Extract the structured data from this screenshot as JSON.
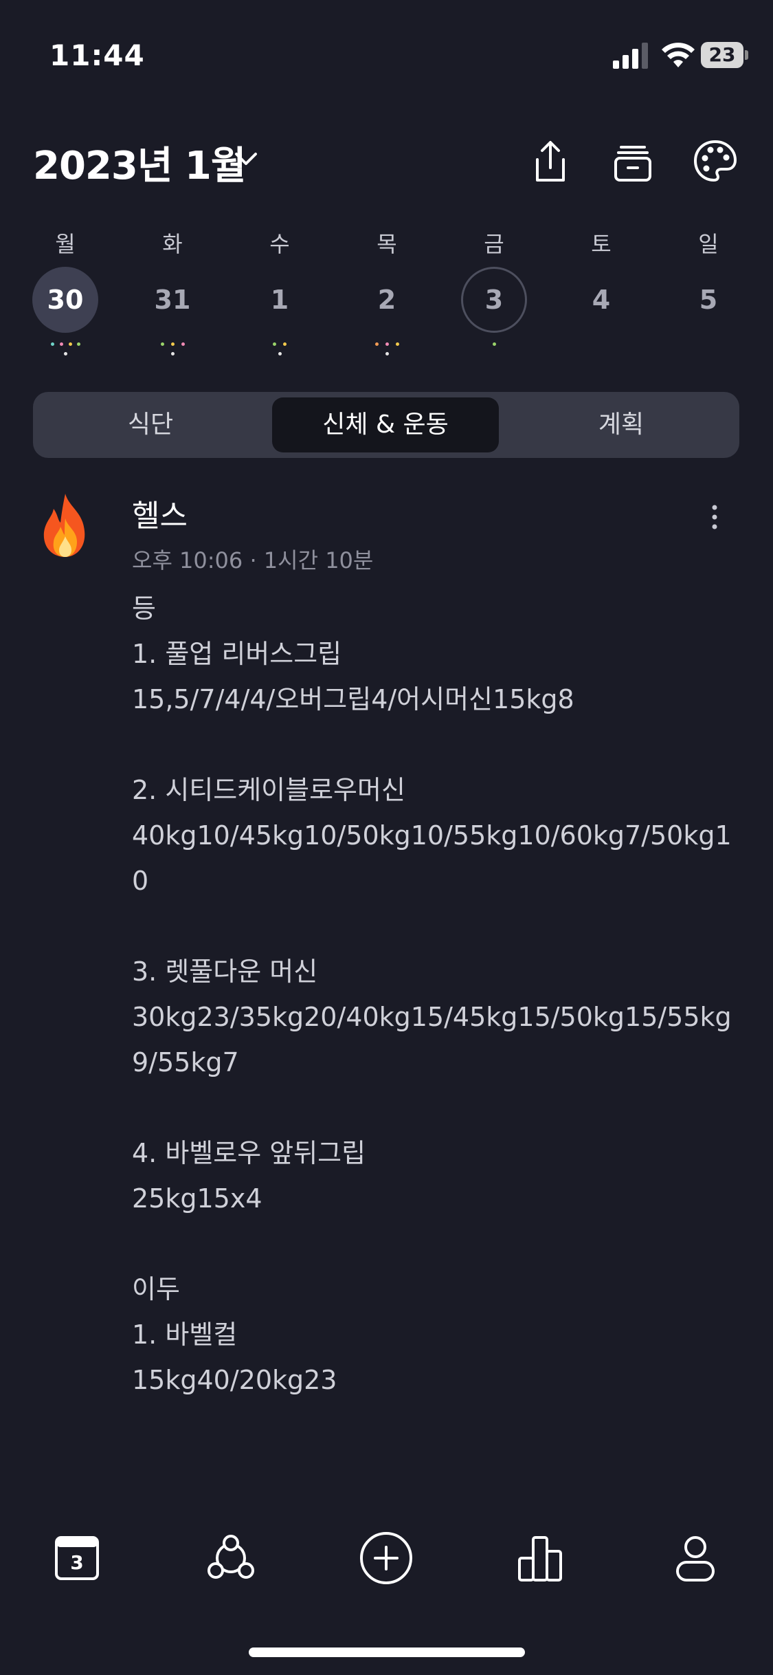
{
  "status_bar": {
    "time": "11:44",
    "battery": "23",
    "icons": [
      "signal-icon",
      "wifi-icon",
      "battery-icon"
    ]
  },
  "header": {
    "month_title": "2023년 1월",
    "icons": [
      "chevron-down-icon",
      "share-icon",
      "archive-icon",
      "palette-icon"
    ]
  },
  "week": [
    {
      "label": "월",
      "num": "30",
      "state": "selected"
    },
    {
      "label": "화",
      "num": "31",
      "state": ""
    },
    {
      "label": "수",
      "num": "1",
      "state": ""
    },
    {
      "label": "목",
      "num": "2",
      "state": ""
    },
    {
      "label": "금",
      "num": "3",
      "state": "today"
    },
    {
      "label": "토",
      "num": "4",
      "state": ""
    },
    {
      "label": "일",
      "num": "5",
      "state": ""
    }
  ],
  "tabs": [
    "식단",
    "신체 & 운동",
    "계획"
  ],
  "active_tab": "신체 & 운동",
  "entry": {
    "icon": "fire-icon",
    "title": "헬스",
    "meta": "오후 10:06 · 1시간 10분",
    "body": "등\n1. 풀업 리버스그립\n15,5/7/4/4/오버그립4/어시머신15kg8\n\n2. 시티드케이블로우머신\n40kg10/45kg10/50kg10/55kg10/60kg7/50kg10\n\n3. 렛풀다운 머신\n30kg23/35kg20/40kg15/45kg15/50kg15/55kg9/55kg7\n\n4. 바벨로우 앞뒤그립\n25kg15x4\n\n이두\n1. 바벨컬\n15kg40/20kg23"
  },
  "tab_bar": {
    "calendar_day": "3",
    "icons": [
      "calendar-icon",
      "community-icon",
      "add-icon",
      "stats-icon",
      "profile-icon"
    ]
  },
  "colors": {
    "background": "#1a1b26",
    "segment_bg": "#373946",
    "segment_active": "#14151c",
    "selected_day": "#3e4052",
    "dot_teal": "#6fd3c8",
    "dot_pink": "#f08ab4",
    "dot_green": "#9ad36a",
    "dot_yellow": "#f2c94c",
    "dot_orange": "#f29b55",
    "dot_white": "#e6e6e6"
  }
}
